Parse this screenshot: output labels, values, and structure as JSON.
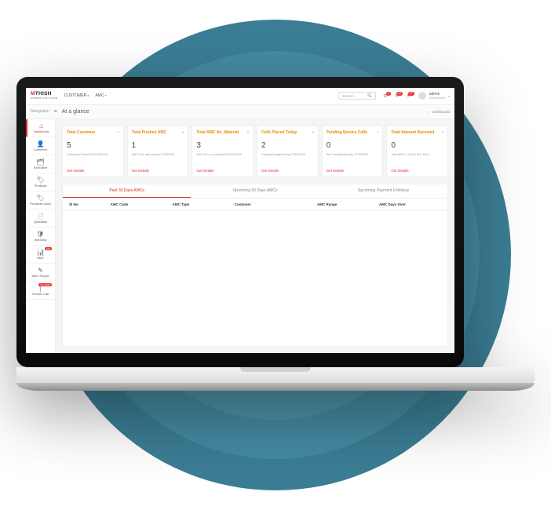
{
  "brand": {
    "name_red": "M",
    "name_rest": "THISH",
    "tagline": "POWER SOLUTION"
  },
  "topnav": {
    "items": [
      "CUSTOMER",
      "AMC"
    ]
  },
  "search": {
    "placeholder": "Search..."
  },
  "notifications": {
    "n1": "2",
    "n2": "13",
    "n3": "17"
  },
  "user": {
    "name": "admin",
    "role": "administrator"
  },
  "subheader": {
    "navigation_label": "Navigation",
    "title": "At a glance",
    "crumb": "Dashboard"
  },
  "sidebar": {
    "items": [
      {
        "icon": "⌂",
        "label": "Dashboard",
        "active": true
      },
      {
        "icon": "👤",
        "label": "Customer"
      },
      {
        "icon": "🗂",
        "label": "Executive"
      },
      {
        "icon": "🏷",
        "label": "Products"
      },
      {
        "icon": "🏷",
        "label": "Products Used"
      },
      {
        "icon": "📄",
        "label": "Quotation"
      },
      {
        "icon": "🛡",
        "label": "Warranty"
      },
      {
        "icon": "📊",
        "label": "AMC",
        "badge": "Add"
      },
      {
        "icon": "✎",
        "label": "AMC Report"
      },
      {
        "icon": "│",
        "label": "Service Call",
        "badge": "Complete"
      }
    ]
  },
  "cards": [
    {
      "title": "Total Customer",
      "value": "5",
      "desc": "Customers Entered till 07/05/2020",
      "link": "Get Details"
    },
    {
      "title": "Total Product AMC",
      "value": "1",
      "desc": "AMC Gen. with product 07/05/2020",
      "link": "Get Details"
    },
    {
      "title": "Total AMC No_Material",
      "value": "3",
      "desc": "AMC Gen. no material till 07/05/2020",
      "link": "Get Details"
    },
    {
      "title": "Calls Placed Today",
      "value": "2",
      "desc": "Complaint lodged today, 07/05/2020",
      "link": "Get Details"
    },
    {
      "title": "Pending Service Calls",
      "value": "0",
      "desc": "Due Complaints today, 07/05/2020",
      "link": "Get Details"
    },
    {
      "title": "Total Amount Received",
      "value": "0",
      "desc": "Total (AMC & CALL) Amt. Recd",
      "link": "Get Details"
    }
  ],
  "panel": {
    "tabs": [
      "Past 30 Days AMCs",
      "Upcoming 30 Days AMCs",
      "Upcoming Payment Followup"
    ],
    "active_tab": 0,
    "columns": [
      "Sl No",
      "AMC Code",
      "AMC Type",
      "Customer",
      "AMC Range",
      "AMC Days Over"
    ]
  }
}
